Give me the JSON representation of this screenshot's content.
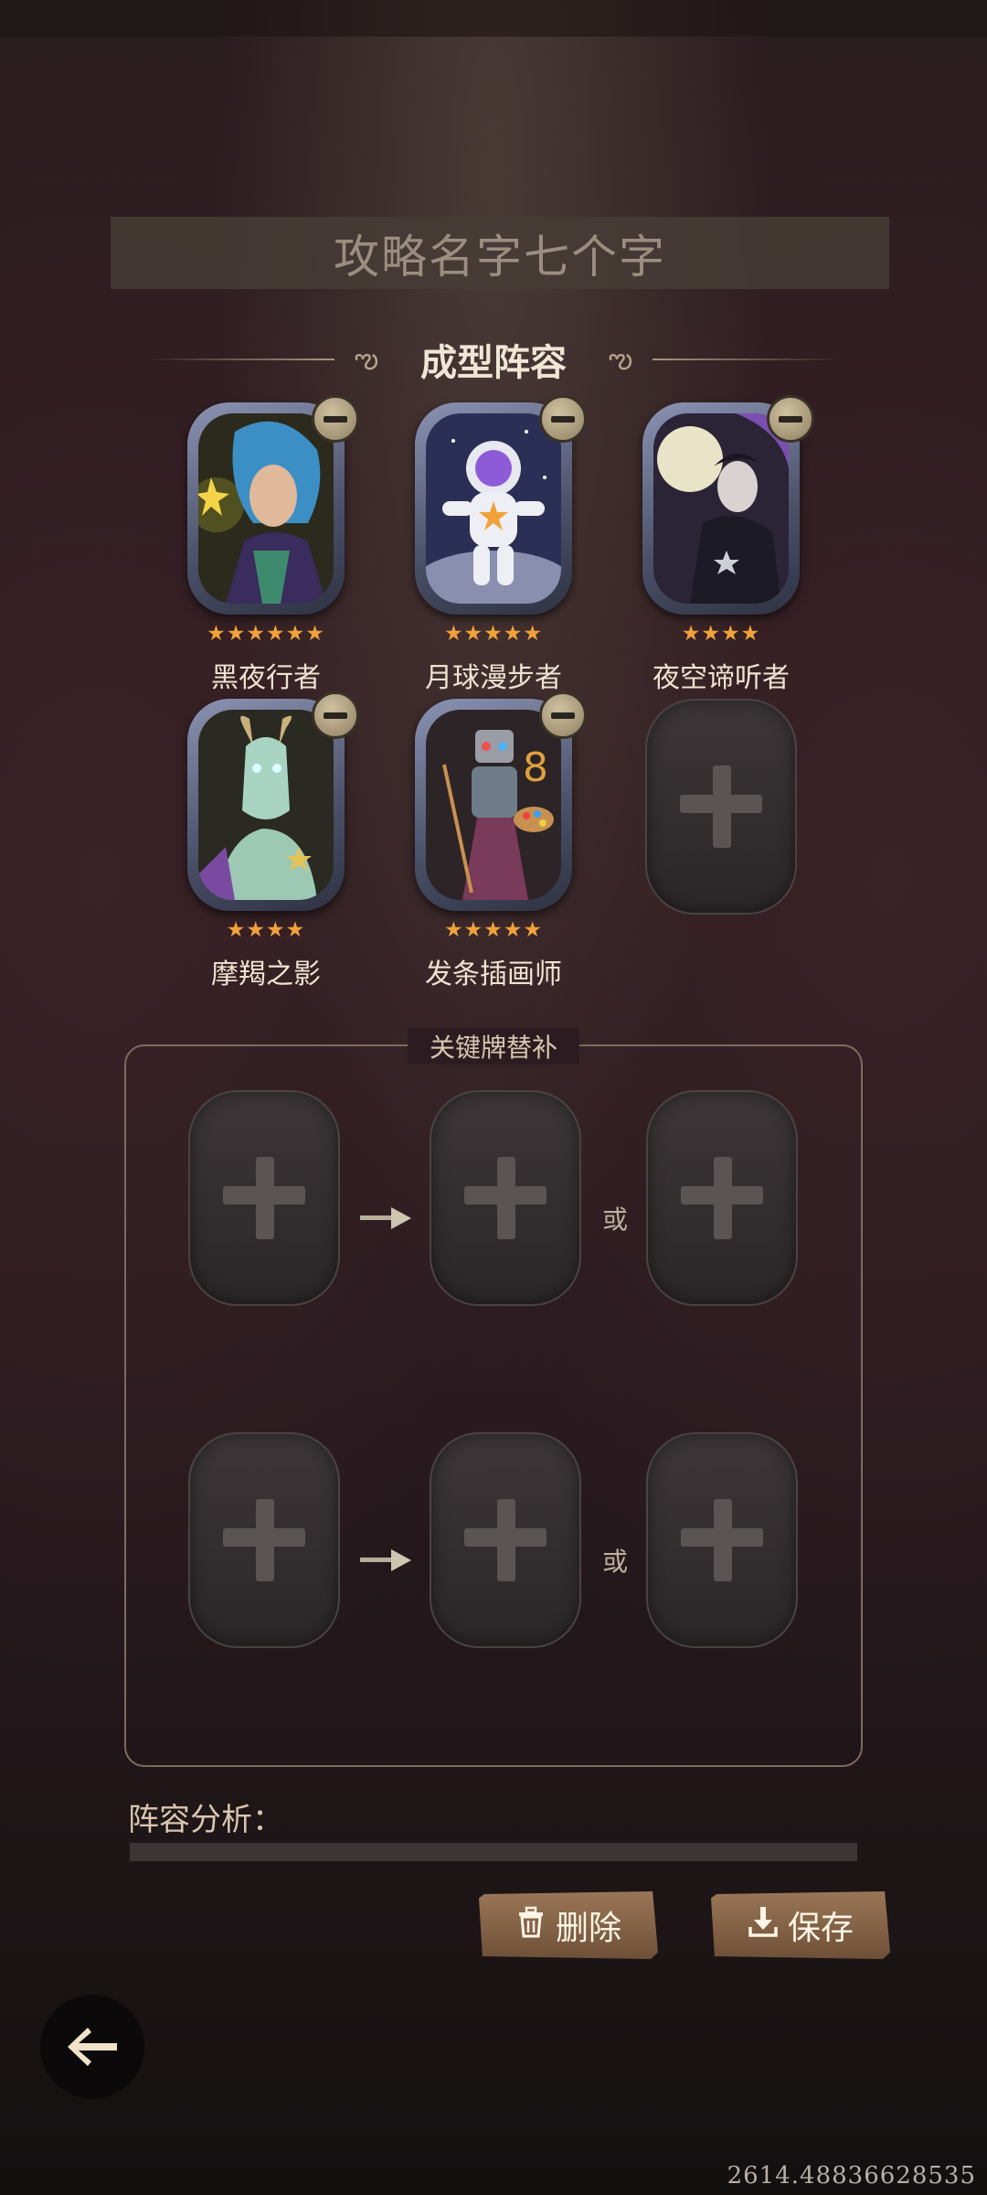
{
  "title": "攻略名字七个字",
  "lineup": {
    "heading": "成型阵容",
    "heroes": [
      {
        "name": "黑夜行者",
        "stars": 6
      },
      {
        "name": "月球漫步者",
        "stars": 5
      },
      {
        "name": "夜空谛听者",
        "stars": 4
      },
      {
        "name": "摩羯之影",
        "stars": 4
      },
      {
        "name": "发条插画师",
        "stars": 5
      }
    ],
    "empty_slots": 1
  },
  "substitutes": {
    "heading": "关键牌替补",
    "or_label": "或",
    "rows": 2
  },
  "analysis": {
    "label": "阵容分析："
  },
  "buttons": {
    "delete_label": "删除",
    "save_label": "保存"
  },
  "footer_number": "2614.48836628535",
  "colors": {
    "star": "#f0a23a",
    "button": "#8a6a4c",
    "frame": "#6e7594"
  }
}
